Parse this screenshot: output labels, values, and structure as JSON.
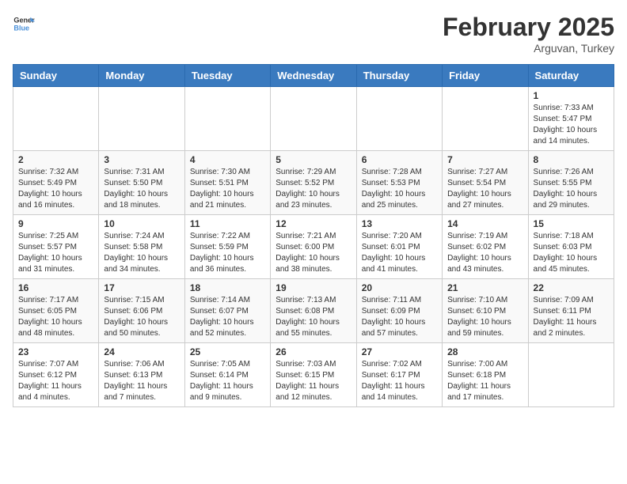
{
  "header": {
    "logo_general": "General",
    "logo_blue": "Blue",
    "month_title": "February 2025",
    "location": "Arguvan, Turkey"
  },
  "weekdays": [
    "Sunday",
    "Monday",
    "Tuesday",
    "Wednesday",
    "Thursday",
    "Friday",
    "Saturday"
  ],
  "weeks": [
    [
      {
        "day": "",
        "info": ""
      },
      {
        "day": "",
        "info": ""
      },
      {
        "day": "",
        "info": ""
      },
      {
        "day": "",
        "info": ""
      },
      {
        "day": "",
        "info": ""
      },
      {
        "day": "",
        "info": ""
      },
      {
        "day": "1",
        "info": "Sunrise: 7:33 AM\nSunset: 5:47 PM\nDaylight: 10 hours and 14 minutes."
      }
    ],
    [
      {
        "day": "2",
        "info": "Sunrise: 7:32 AM\nSunset: 5:49 PM\nDaylight: 10 hours and 16 minutes."
      },
      {
        "day": "3",
        "info": "Sunrise: 7:31 AM\nSunset: 5:50 PM\nDaylight: 10 hours and 18 minutes."
      },
      {
        "day": "4",
        "info": "Sunrise: 7:30 AM\nSunset: 5:51 PM\nDaylight: 10 hours and 21 minutes."
      },
      {
        "day": "5",
        "info": "Sunrise: 7:29 AM\nSunset: 5:52 PM\nDaylight: 10 hours and 23 minutes."
      },
      {
        "day": "6",
        "info": "Sunrise: 7:28 AM\nSunset: 5:53 PM\nDaylight: 10 hours and 25 minutes."
      },
      {
        "day": "7",
        "info": "Sunrise: 7:27 AM\nSunset: 5:54 PM\nDaylight: 10 hours and 27 minutes."
      },
      {
        "day": "8",
        "info": "Sunrise: 7:26 AM\nSunset: 5:55 PM\nDaylight: 10 hours and 29 minutes."
      }
    ],
    [
      {
        "day": "9",
        "info": "Sunrise: 7:25 AM\nSunset: 5:57 PM\nDaylight: 10 hours and 31 minutes."
      },
      {
        "day": "10",
        "info": "Sunrise: 7:24 AM\nSunset: 5:58 PM\nDaylight: 10 hours and 34 minutes."
      },
      {
        "day": "11",
        "info": "Sunrise: 7:22 AM\nSunset: 5:59 PM\nDaylight: 10 hours and 36 minutes."
      },
      {
        "day": "12",
        "info": "Sunrise: 7:21 AM\nSunset: 6:00 PM\nDaylight: 10 hours and 38 minutes."
      },
      {
        "day": "13",
        "info": "Sunrise: 7:20 AM\nSunset: 6:01 PM\nDaylight: 10 hours and 41 minutes."
      },
      {
        "day": "14",
        "info": "Sunrise: 7:19 AM\nSunset: 6:02 PM\nDaylight: 10 hours and 43 minutes."
      },
      {
        "day": "15",
        "info": "Sunrise: 7:18 AM\nSunset: 6:03 PM\nDaylight: 10 hours and 45 minutes."
      }
    ],
    [
      {
        "day": "16",
        "info": "Sunrise: 7:17 AM\nSunset: 6:05 PM\nDaylight: 10 hours and 48 minutes."
      },
      {
        "day": "17",
        "info": "Sunrise: 7:15 AM\nSunset: 6:06 PM\nDaylight: 10 hours and 50 minutes."
      },
      {
        "day": "18",
        "info": "Sunrise: 7:14 AM\nSunset: 6:07 PM\nDaylight: 10 hours and 52 minutes."
      },
      {
        "day": "19",
        "info": "Sunrise: 7:13 AM\nSunset: 6:08 PM\nDaylight: 10 hours and 55 minutes."
      },
      {
        "day": "20",
        "info": "Sunrise: 7:11 AM\nSunset: 6:09 PM\nDaylight: 10 hours and 57 minutes."
      },
      {
        "day": "21",
        "info": "Sunrise: 7:10 AM\nSunset: 6:10 PM\nDaylight: 10 hours and 59 minutes."
      },
      {
        "day": "22",
        "info": "Sunrise: 7:09 AM\nSunset: 6:11 PM\nDaylight: 11 hours and 2 minutes."
      }
    ],
    [
      {
        "day": "23",
        "info": "Sunrise: 7:07 AM\nSunset: 6:12 PM\nDaylight: 11 hours and 4 minutes."
      },
      {
        "day": "24",
        "info": "Sunrise: 7:06 AM\nSunset: 6:13 PM\nDaylight: 11 hours and 7 minutes."
      },
      {
        "day": "25",
        "info": "Sunrise: 7:05 AM\nSunset: 6:14 PM\nDaylight: 11 hours and 9 minutes."
      },
      {
        "day": "26",
        "info": "Sunrise: 7:03 AM\nSunset: 6:15 PM\nDaylight: 11 hours and 12 minutes."
      },
      {
        "day": "27",
        "info": "Sunrise: 7:02 AM\nSunset: 6:17 PM\nDaylight: 11 hours and 14 minutes."
      },
      {
        "day": "28",
        "info": "Sunrise: 7:00 AM\nSunset: 6:18 PM\nDaylight: 11 hours and 17 minutes."
      },
      {
        "day": "",
        "info": ""
      }
    ]
  ]
}
